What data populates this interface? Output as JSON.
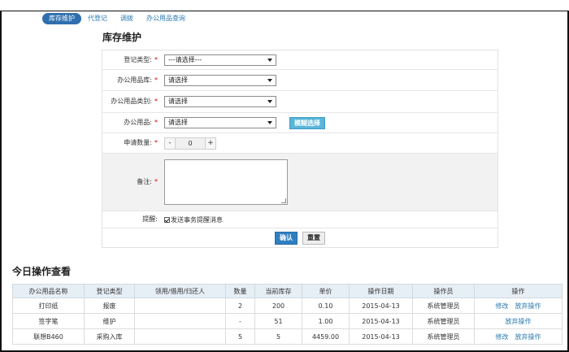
{
  "tabs": [
    {
      "label": "库存维护",
      "active": true
    },
    {
      "label": "代登记",
      "active": false
    },
    {
      "label": "调拨",
      "active": false
    },
    {
      "label": "办公用品查询",
      "active": false
    }
  ],
  "form": {
    "title": "库存维护",
    "register_type": {
      "label": "登记类型:",
      "value": "---请选择---"
    },
    "warehouse": {
      "label": "办公用品库:",
      "value": "请选择"
    },
    "category": {
      "label": "办公用品类别:",
      "value": "请选择"
    },
    "item": {
      "label": "办公用品:",
      "value": "请选择",
      "button": "模糊选择"
    },
    "quantity": {
      "label": "申请数量:",
      "minus": "-",
      "value": "0",
      "plus": "+"
    },
    "remark": {
      "label": "备注:"
    },
    "reminder": {
      "label": "提醒:",
      "checkbox_label": "发送事务提醒消息",
      "checked": true
    },
    "required_mark": "*",
    "confirm_label": "确认",
    "reset_label": "重置"
  },
  "today": {
    "title": "今日操作查看",
    "columns": [
      "办公用品名称",
      "登记类型",
      "领用/借用/归还人",
      "数量",
      "当前库存",
      "单价",
      "操作日期",
      "操作员",
      "操作"
    ],
    "rows": [
      {
        "name": "打印纸",
        "type": "报废",
        "person": "",
        "qty": "2",
        "stock": "200",
        "price": "0.10",
        "date": "2015-04-13",
        "operator": "系统管理员",
        "actions": [
          "修改",
          "放弃操作"
        ]
      },
      {
        "name": "签字笔",
        "type": "维护",
        "person": "",
        "qty": "-",
        "stock": "51",
        "price": "1.00",
        "date": "2015-04-13",
        "operator": "系统管理员",
        "actions": [
          "放弃操作"
        ]
      },
      {
        "name": "联想B460",
        "type": "采购入库",
        "person": "",
        "qty": "5",
        "stock": "5",
        "price": "4459.00",
        "date": "2015-04-13",
        "operator": "系统管理员",
        "actions": [
          "修改",
          "放弃操作"
        ]
      }
    ]
  },
  "colors": {
    "accent": "#2f6fae",
    "link": "#2a7ab0",
    "required": "#dd0000",
    "header_bg": "#e6eef6"
  }
}
